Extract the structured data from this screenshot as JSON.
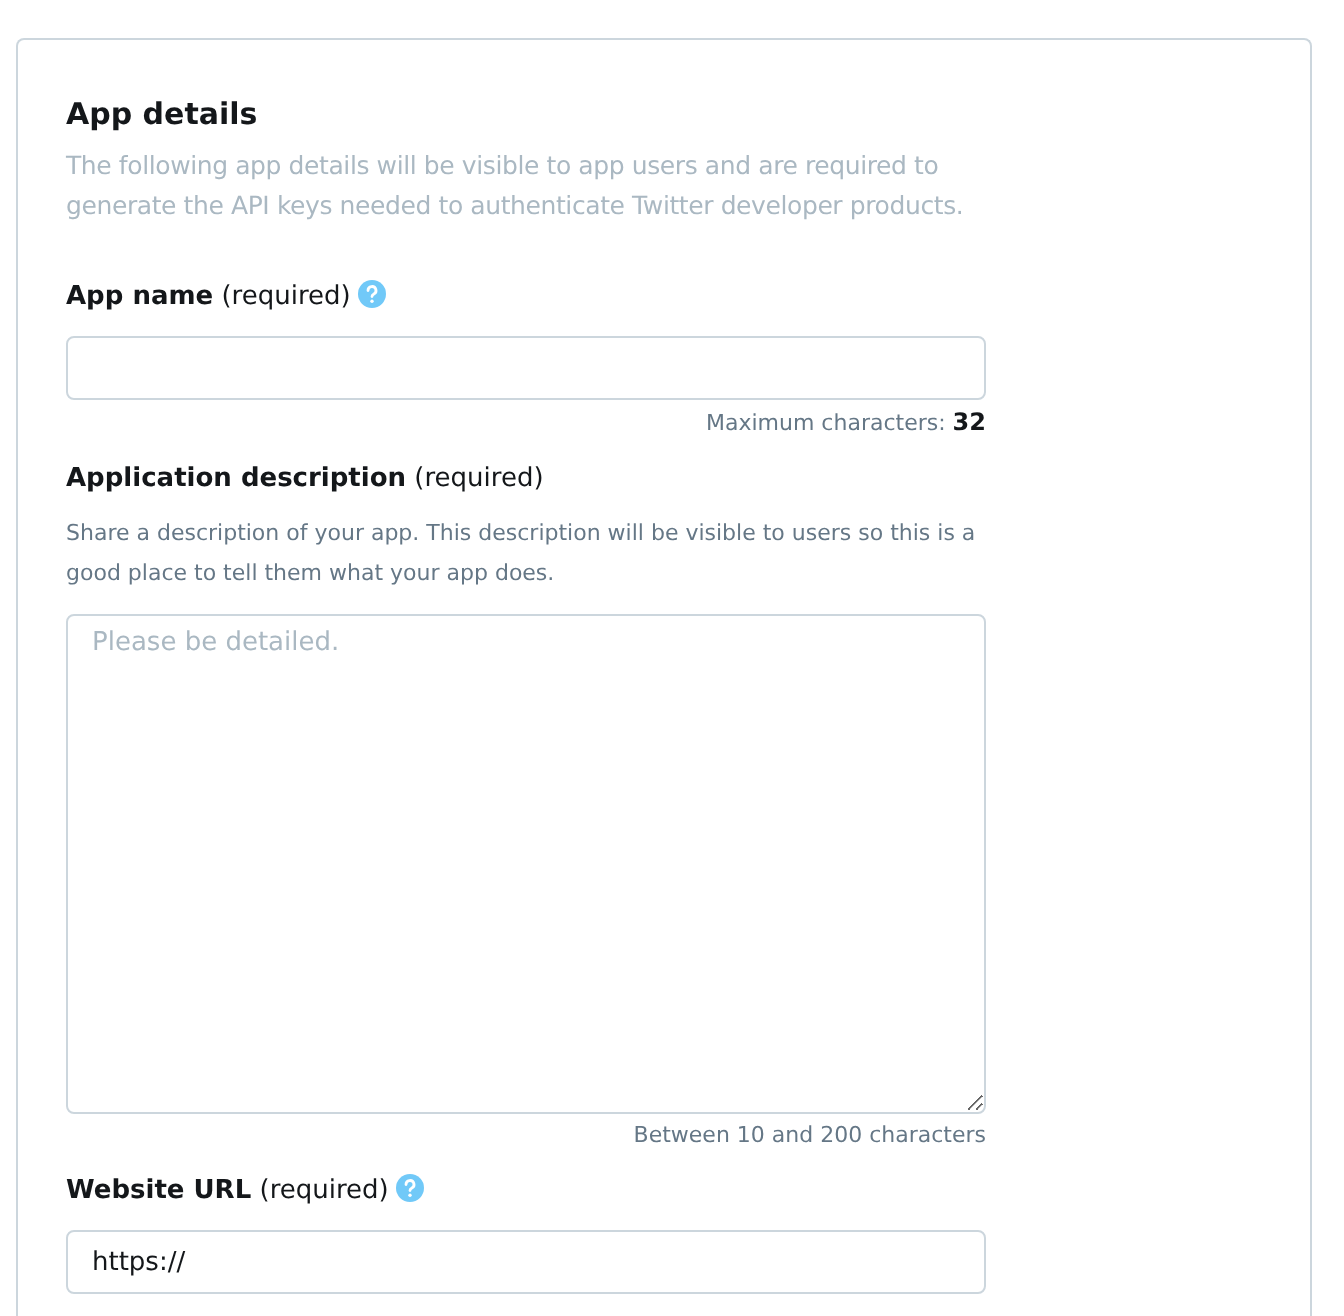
{
  "section": {
    "title": "App details",
    "description": "The following app details will be visible to app users and are required to generate the API keys needed to authenticate Twitter developer products."
  },
  "fields": [
    {
      "kind": "input",
      "label": "**App name** (required)",
      "help": true,
      "hint": "Maximum characters: **32**"
    },
    {
      "kind": "textarea",
      "label": "**Application description** (required)",
      "help": false,
      "description": "Share a description of your app. This description will be visible to users so this is a good place to tell them what your app does.",
      "placeholder": "Please be detailed.",
      "hint": "Between 10 and 200 characters"
    },
    {
      "kind": "input",
      "label": "**Website URL** (required)",
      "help": true,
      "value": "https://"
    }
  ]
}
